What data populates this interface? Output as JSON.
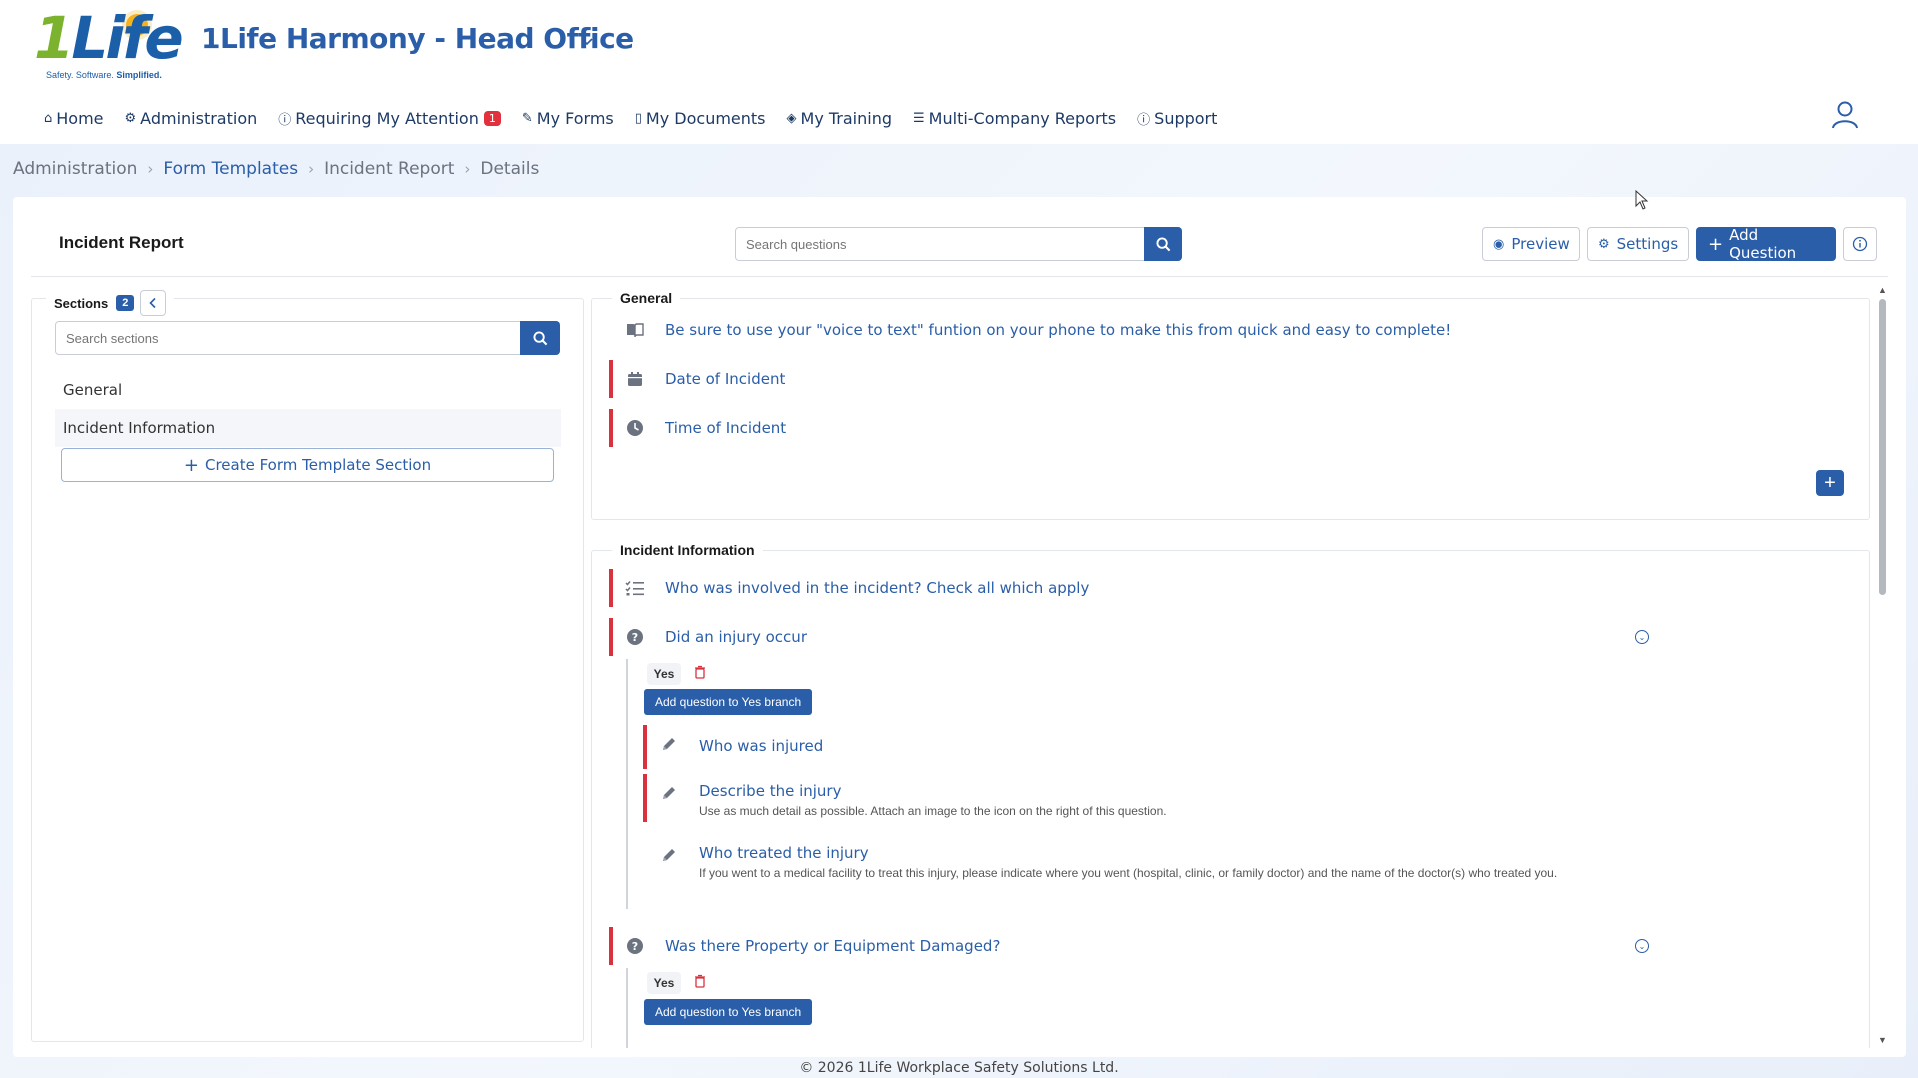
{
  "app": {
    "logo_one": "1",
    "logo_life": "Life",
    "logo_tagline": "Safety. Software.",
    "logo_tagline_bold": "Simplified.",
    "company_name": "1Life Harmony - Head Office"
  },
  "nav": {
    "items": [
      {
        "label": "Home",
        "icon": "home-icon"
      },
      {
        "label": "Administration",
        "icon": "gear-icon"
      },
      {
        "label": "Requiring My Attention",
        "icon": "alert-circle-icon",
        "badge": "1"
      },
      {
        "label": "My Forms",
        "icon": "edit-form-icon"
      },
      {
        "label": "My Documents",
        "icon": "document-icon"
      },
      {
        "label": "My Training",
        "icon": "graduation-cap-icon"
      },
      {
        "label": "Multi-Company Reports",
        "icon": "report-icon"
      },
      {
        "label": "Support",
        "icon": "info-circle-icon"
      }
    ]
  },
  "breadcrumb": [
    "Administration",
    "Form Templates",
    "Incident Report",
    "Details"
  ],
  "header": {
    "title": "Incident Report",
    "search_placeholder": "Search questions",
    "preview_label": "Preview",
    "settings_label": "Settings",
    "add_question_label": "Add Question"
  },
  "sections": {
    "label": "Sections",
    "count": "2",
    "search_placeholder": "Search sections",
    "items": [
      "General",
      "Incident Information"
    ],
    "create_label": "Create Form Template Section"
  },
  "general": {
    "title": "General",
    "note": "Be sure to use your \"voice to text\" funtion on your phone to make this from quick and easy to complete!",
    "questions": [
      "Date of Incident",
      "Time of Incident"
    ]
  },
  "incident": {
    "title": "Incident Information",
    "q_involved": "Who was involved in the incident? Check all which apply",
    "q_injury": "Did an injury occur",
    "yes_label": "Yes",
    "branch_button": "Add question to Yes branch",
    "sub_questions": [
      {
        "title": "Who was injured",
        "note": ""
      },
      {
        "title": "Describe the injury",
        "note": "Use as much detail as possible. Attach an image to the icon on the right of this question."
      },
      {
        "title": "Who treated the injury",
        "note": "If you went to a medical facility to treat this injury, please indicate where you went (hospital, clinic, or family doctor) and the name of the doctor(s) who treated you."
      }
    ],
    "q_property": "Was there Property or Equipment Damaged?"
  },
  "footer": "© 2026 1Life Workplace Safety Solutions Ltd.",
  "colors": {
    "primary": "#2a5ea8",
    "danger": "#d9313d",
    "logo_green": "#7bb32e"
  }
}
